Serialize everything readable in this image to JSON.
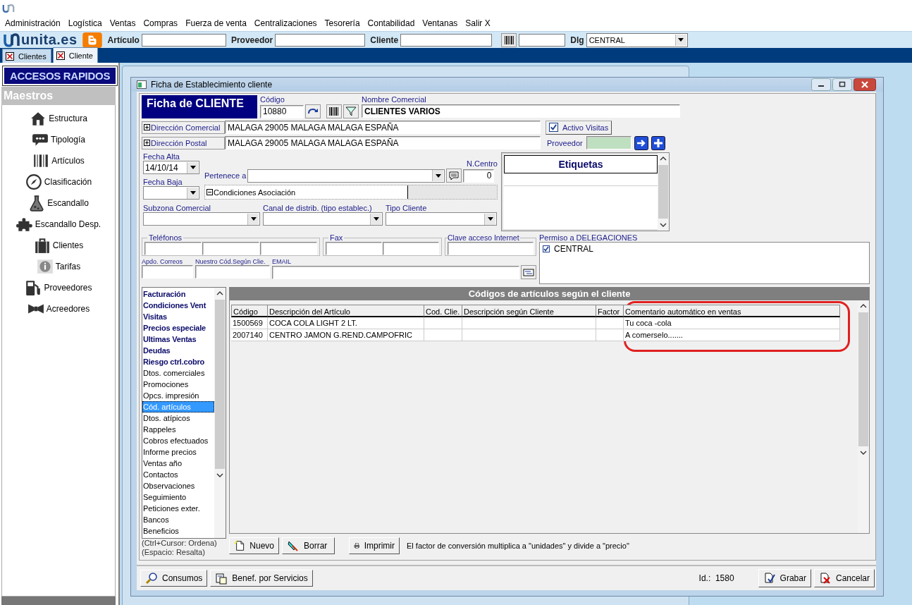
{
  "menu": [
    "Administración",
    "Logística",
    "Ventas",
    "Compras",
    "Fuerza de venta",
    "Centralizaciones",
    "Tesorería",
    "Contabilidad",
    "Ventanas",
    "Salir X"
  ],
  "toolbar": {
    "logo": "unita.es",
    "fields": [
      {
        "label": "Artículo"
      },
      {
        "label": "Proveedor"
      },
      {
        "label": "Cliente"
      }
    ],
    "dlg": {
      "label": "Dlg",
      "value": "CENTRAL"
    }
  },
  "tabs": [
    {
      "label": "Clientes",
      "selected": false
    },
    {
      "label": "Cliente",
      "selected": true
    }
  ],
  "sidebar": {
    "title": "ACCESOS RAPIDOS",
    "section": "Maestros",
    "items": [
      "Estructura",
      "Tipología",
      "Artículos",
      "Clasificación",
      "Escandallo",
      "Escandallo Desp.",
      "Clientes",
      "Tarifas",
      "Proveedores",
      "Acreedores"
    ]
  },
  "dialog": {
    "title": "Ficha de Establecimiento cliente",
    "heading": "Ficha de CLIENTE",
    "codigo": {
      "label": "Código",
      "value": "10880"
    },
    "nombre": {
      "label": "Nombre Comercial",
      "value": "CLIENTES VARIOS"
    },
    "direcciones": [
      {
        "label": "Dirección Comercial",
        "value": "MALAGA 29005 MALAGA MALAGA ESPAÑA"
      },
      {
        "label": "Dirección Postal",
        "value": "MALAGA 29005 MALAGA MALAGA ESPAÑA"
      }
    ],
    "activo_visitas": {
      "label": "Activo Visitas",
      "checked": true
    },
    "proveedor": {
      "label": "Proveedor"
    },
    "fecha_alta": {
      "label": "Fecha Alta",
      "value": "14/10/14"
    },
    "fecha_baja": {
      "label": "Fecha Baja"
    },
    "pertenece": {
      "label": "Pertenece a"
    },
    "n_centro": {
      "label": "N.Centro",
      "value": "0"
    },
    "condiciones": {
      "label": "Condiciones Asociación"
    },
    "selects": [
      {
        "label": "Subzona Comercial"
      },
      {
        "label": "Canal de distrib. (tipo establec.)"
      },
      {
        "label": "Tipo Cliente"
      }
    ],
    "telefonos": {
      "label": "Teléfonos"
    },
    "fax": {
      "label": "Fax"
    },
    "clave": {
      "label": "Clave acceso Internet"
    },
    "apdo": {
      "label": "Apdo. Correos"
    },
    "nuestro": {
      "label": "Nuestro Cód.Según Clie."
    },
    "email": {
      "label": "EMAIL"
    },
    "etiquetas": {
      "title": "Etiquetas"
    },
    "permiso": {
      "label": "Permiso a DELEGACIONES",
      "items": [
        {
          "label": "CENTRAL",
          "checked": true
        }
      ]
    },
    "sections": [
      {
        "label": "Facturación",
        "bold": true,
        "selected": false
      },
      {
        "label": "Condiciones Vent",
        "bold": true,
        "selected": false
      },
      {
        "label": "Visitas",
        "bold": true,
        "selected": false
      },
      {
        "label": "Precios especiale",
        "bold": true,
        "selected": false
      },
      {
        "label": "Ultimas Ventas",
        "bold": true,
        "selected": false
      },
      {
        "label": "Deudas",
        "bold": true,
        "selected": false
      },
      {
        "label": "Riesgo ctrl.cobro",
        "bold": true,
        "selected": false
      },
      {
        "label": "Dtos. comerciales",
        "bold": false,
        "selected": false
      },
      {
        "label": "Promociones",
        "bold": false,
        "selected": false
      },
      {
        "label": "Opcs. impresión",
        "bold": false,
        "selected": false
      },
      {
        "label": "Cód. artículos",
        "bold": false,
        "selected": true
      },
      {
        "label": "Dtos. atípicos",
        "bold": false,
        "selected": false
      },
      {
        "label": "Rappeles",
        "bold": false,
        "selected": false
      },
      {
        "label": "Cobros efectuados",
        "bold": false,
        "selected": false
      },
      {
        "label": "Informe precios",
        "bold": false,
        "selected": false
      },
      {
        "label": "Ventas año",
        "bold": false,
        "selected": false
      },
      {
        "label": "Contactos",
        "bold": false,
        "selected": false
      },
      {
        "label": "Observaciones",
        "bold": false,
        "selected": false
      },
      {
        "label": "Seguimiento",
        "bold": false,
        "selected": false
      },
      {
        "label": "Peticiones exter.",
        "bold": false,
        "selected": false
      },
      {
        "label": "Bancos",
        "bold": false,
        "selected": false
      },
      {
        "label": "Beneficios",
        "bold": false,
        "selected": false
      }
    ],
    "hints": [
      "(Ctrl+Cursor: Ordena)",
      "(Espacio: Resalta)"
    ],
    "grid": {
      "title": "Códigos de artículos según el cliente",
      "columns": [
        {
          "label": "Código",
          "highlighted": false
        },
        {
          "label": "Descripción del Artículo",
          "highlighted": false
        },
        {
          "label": "Cod. Clie.",
          "highlighted": false
        },
        {
          "label": "Descripción según Cliente",
          "highlighted": false
        },
        {
          "label": "Factor",
          "highlighted": false
        },
        {
          "label": "Comentario automático en ventas",
          "highlighted": true
        }
      ],
      "rows": [
        [
          "1500569",
          "COCA COLA LIGHT 2 LT.",
          null,
          null,
          null,
          "Tu coca -cola"
        ],
        [
          "2007140",
          "CENTRO JAMON G.REND.CAMPOFRIC",
          null,
          null,
          null,
          "A comerselo......."
        ]
      ]
    },
    "grid_buttons": [
      "Nuevo",
      "Borrar",
      "Imprimir"
    ],
    "note": "El factor de conversión multiplica a \"unidades\" y divide a \"precio\"",
    "footer_buttons": [
      "Consumos",
      "Benef. por Servicios"
    ],
    "id_label": "Id.:",
    "id_value": "1580",
    "actions": [
      "Grabar",
      "Cancelar"
    ]
  }
}
